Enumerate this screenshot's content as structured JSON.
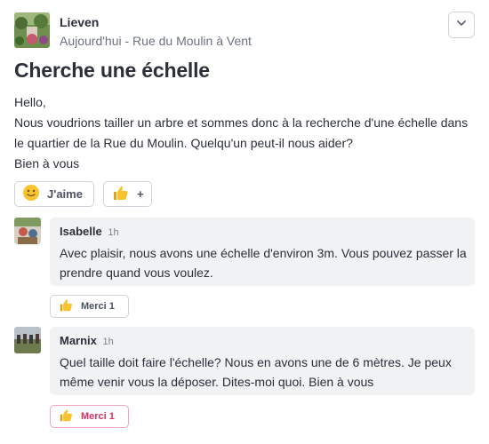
{
  "post": {
    "author": "Lieven",
    "meta": "Aujourd'hui - Rue du Moulin à Vent",
    "title": "Cherche une échelle",
    "body_lines": [
      "Hello,",
      "Nous voudrions tailler un arbre et sommes donc à la recherche d'une échelle dans",
      "le quartier de la Rue du Moulin. Quelqu'un peut-il nous aider?",
      "Bien à vous"
    ],
    "like_label": "J'aime",
    "add_reaction_label": "+",
    "menu_icon": "chevron-down-icon"
  },
  "comments": [
    {
      "name": "Isabelle",
      "time": "1h",
      "lines": [
        "Avec plaisir, nous avons une échelle d'environ 3m. Vous pouvez passer la",
        "prendre quand vous voulez."
      ],
      "thanks_label": "Merci 1",
      "thanks_active": false
    },
    {
      "name": "Marnix",
      "time": "1h",
      "lines": [
        "Quel taille doit faire l'échelle? Nous en avons une de 6 mètres. Je peux",
        "même venir vous la déposer. Dites-moi quoi. Bien à vous"
      ],
      "thanks_label": "Merci 1",
      "thanks_active": true
    }
  ],
  "colors": {
    "text": "#2b2f3a",
    "muted": "#6b7280",
    "bubble": "#f1f2f4",
    "border": "#cfd4dc",
    "accent_pink": "#d6315f"
  }
}
